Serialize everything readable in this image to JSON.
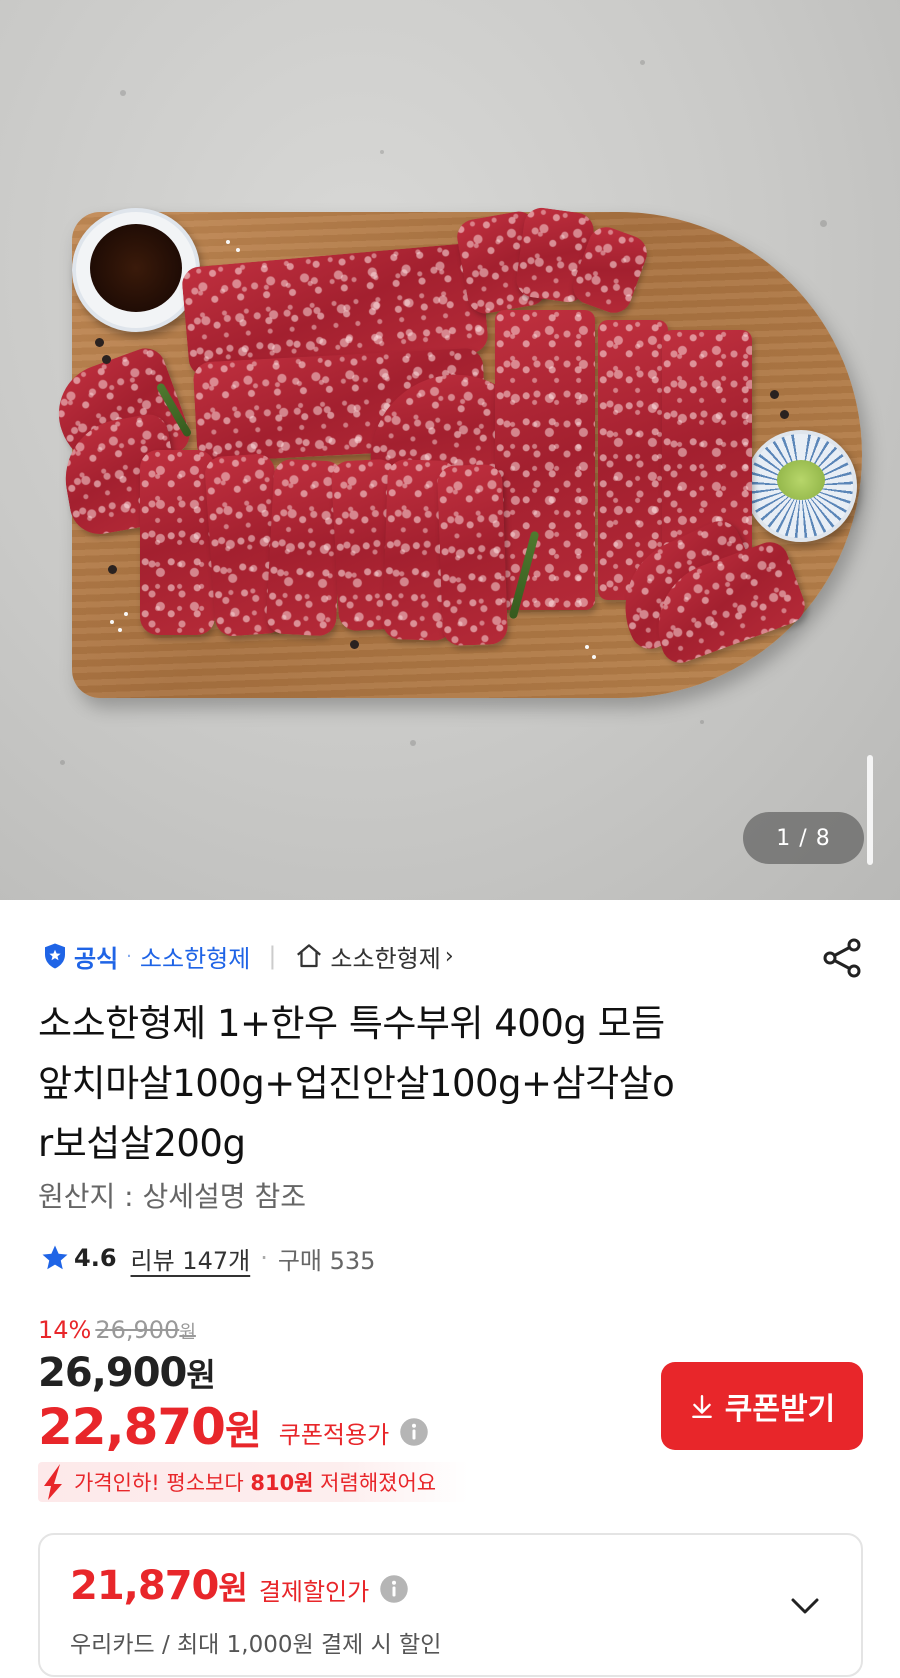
{
  "gallery": {
    "counter": "1 / 8"
  },
  "store": {
    "official_label": "공식",
    "store_name": "소소한형제",
    "home_label": "소소한형제",
    "chevron": "›"
  },
  "product": {
    "title_lines": [
      "소소한형제 1+한우 특수부위 400g 모듬",
      "앞치마살100g+업진안살100g+삼각살o",
      "r보섭살200g"
    ],
    "origin": "원산지 : 상세설명 참조",
    "rating": "4.6",
    "review": "리뷰 147개",
    "purchase": "구매 535"
  },
  "pricing": {
    "discount_pct": "14%",
    "original_price": "26,900",
    "original_unit": "원",
    "price": "26,900",
    "price_unit": "원",
    "coupon_price": "22,870",
    "coupon_unit": "원",
    "coupon_label": "쿠폰적용가",
    "coupon_button": "쿠폰받기",
    "drop_prefix": "가격인하! 평소보다 ",
    "drop_amount": "810원",
    "drop_suffix": " 저렴해졌어요"
  },
  "payment": {
    "price": "21,870",
    "unit": "원",
    "label": "결제할인가",
    "desc": "우리카드 / 최대 1,000원 결제 시 할인"
  },
  "colors": {
    "accent_red": "#e8262a",
    "brand_blue": "#1f64e6"
  },
  "icons": [
    "official-badge-icon",
    "home-icon",
    "share-icon",
    "star-icon",
    "info-icon",
    "download-icon",
    "price-drop-arrow-icon",
    "chevron-down-icon"
  ]
}
